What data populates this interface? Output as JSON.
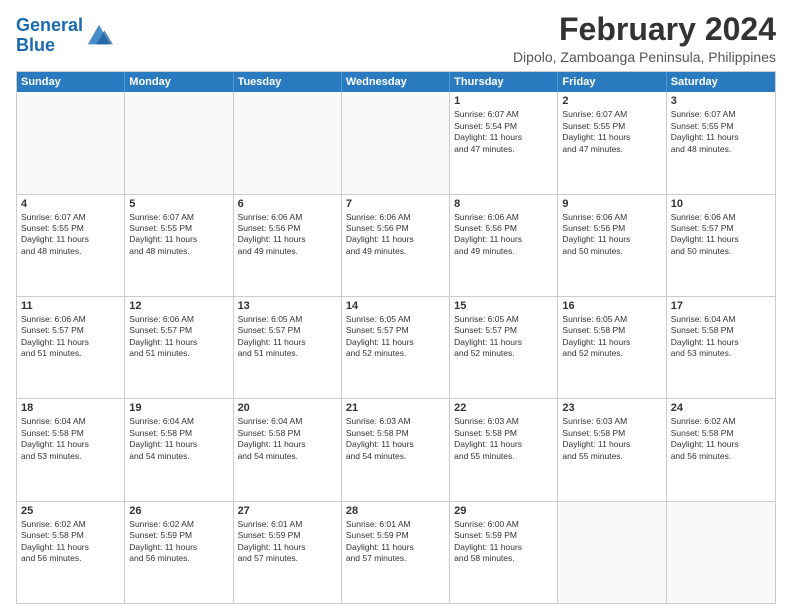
{
  "logo": {
    "line1": "General",
    "line2": "Blue"
  },
  "title": "February 2024",
  "subtitle": "Dipolo, Zamboanga Peninsula, Philippines",
  "header_days": [
    "Sunday",
    "Monday",
    "Tuesday",
    "Wednesday",
    "Thursday",
    "Friday",
    "Saturday"
  ],
  "weeks": [
    [
      {
        "day": "",
        "info": ""
      },
      {
        "day": "",
        "info": ""
      },
      {
        "day": "",
        "info": ""
      },
      {
        "day": "",
        "info": ""
      },
      {
        "day": "1",
        "info": "Sunrise: 6:07 AM\nSunset: 5:54 PM\nDaylight: 11 hours\nand 47 minutes."
      },
      {
        "day": "2",
        "info": "Sunrise: 6:07 AM\nSunset: 5:55 PM\nDaylight: 11 hours\nand 47 minutes."
      },
      {
        "day": "3",
        "info": "Sunrise: 6:07 AM\nSunset: 5:55 PM\nDaylight: 11 hours\nand 48 minutes."
      }
    ],
    [
      {
        "day": "4",
        "info": "Sunrise: 6:07 AM\nSunset: 5:55 PM\nDaylight: 11 hours\nand 48 minutes."
      },
      {
        "day": "5",
        "info": "Sunrise: 6:07 AM\nSunset: 5:55 PM\nDaylight: 11 hours\nand 48 minutes."
      },
      {
        "day": "6",
        "info": "Sunrise: 6:06 AM\nSunset: 5:56 PM\nDaylight: 11 hours\nand 49 minutes."
      },
      {
        "day": "7",
        "info": "Sunrise: 6:06 AM\nSunset: 5:56 PM\nDaylight: 11 hours\nand 49 minutes."
      },
      {
        "day": "8",
        "info": "Sunrise: 6:06 AM\nSunset: 5:56 PM\nDaylight: 11 hours\nand 49 minutes."
      },
      {
        "day": "9",
        "info": "Sunrise: 6:06 AM\nSunset: 5:56 PM\nDaylight: 11 hours\nand 50 minutes."
      },
      {
        "day": "10",
        "info": "Sunrise: 6:06 AM\nSunset: 5:57 PM\nDaylight: 11 hours\nand 50 minutes."
      }
    ],
    [
      {
        "day": "11",
        "info": "Sunrise: 6:06 AM\nSunset: 5:57 PM\nDaylight: 11 hours\nand 51 minutes."
      },
      {
        "day": "12",
        "info": "Sunrise: 6:06 AM\nSunset: 5:57 PM\nDaylight: 11 hours\nand 51 minutes."
      },
      {
        "day": "13",
        "info": "Sunrise: 6:05 AM\nSunset: 5:57 PM\nDaylight: 11 hours\nand 51 minutes."
      },
      {
        "day": "14",
        "info": "Sunrise: 6:05 AM\nSunset: 5:57 PM\nDaylight: 11 hours\nand 52 minutes."
      },
      {
        "day": "15",
        "info": "Sunrise: 6:05 AM\nSunset: 5:57 PM\nDaylight: 11 hours\nand 52 minutes."
      },
      {
        "day": "16",
        "info": "Sunrise: 6:05 AM\nSunset: 5:58 PM\nDaylight: 11 hours\nand 52 minutes."
      },
      {
        "day": "17",
        "info": "Sunrise: 6:04 AM\nSunset: 5:58 PM\nDaylight: 11 hours\nand 53 minutes."
      }
    ],
    [
      {
        "day": "18",
        "info": "Sunrise: 6:04 AM\nSunset: 5:58 PM\nDaylight: 11 hours\nand 53 minutes."
      },
      {
        "day": "19",
        "info": "Sunrise: 6:04 AM\nSunset: 5:58 PM\nDaylight: 11 hours\nand 54 minutes."
      },
      {
        "day": "20",
        "info": "Sunrise: 6:04 AM\nSunset: 5:58 PM\nDaylight: 11 hours\nand 54 minutes."
      },
      {
        "day": "21",
        "info": "Sunrise: 6:03 AM\nSunset: 5:58 PM\nDaylight: 11 hours\nand 54 minutes."
      },
      {
        "day": "22",
        "info": "Sunrise: 6:03 AM\nSunset: 5:58 PM\nDaylight: 11 hours\nand 55 minutes."
      },
      {
        "day": "23",
        "info": "Sunrise: 6:03 AM\nSunset: 5:58 PM\nDaylight: 11 hours\nand 55 minutes."
      },
      {
        "day": "24",
        "info": "Sunrise: 6:02 AM\nSunset: 5:58 PM\nDaylight: 11 hours\nand 56 minutes."
      }
    ],
    [
      {
        "day": "25",
        "info": "Sunrise: 6:02 AM\nSunset: 5:58 PM\nDaylight: 11 hours\nand 56 minutes."
      },
      {
        "day": "26",
        "info": "Sunrise: 6:02 AM\nSunset: 5:59 PM\nDaylight: 11 hours\nand 56 minutes."
      },
      {
        "day": "27",
        "info": "Sunrise: 6:01 AM\nSunset: 5:59 PM\nDaylight: 11 hours\nand 57 minutes."
      },
      {
        "day": "28",
        "info": "Sunrise: 6:01 AM\nSunset: 5:59 PM\nDaylight: 11 hours\nand 57 minutes."
      },
      {
        "day": "29",
        "info": "Sunrise: 6:00 AM\nSunset: 5:59 PM\nDaylight: 11 hours\nand 58 minutes."
      },
      {
        "day": "",
        "info": ""
      },
      {
        "day": "",
        "info": ""
      }
    ]
  ]
}
